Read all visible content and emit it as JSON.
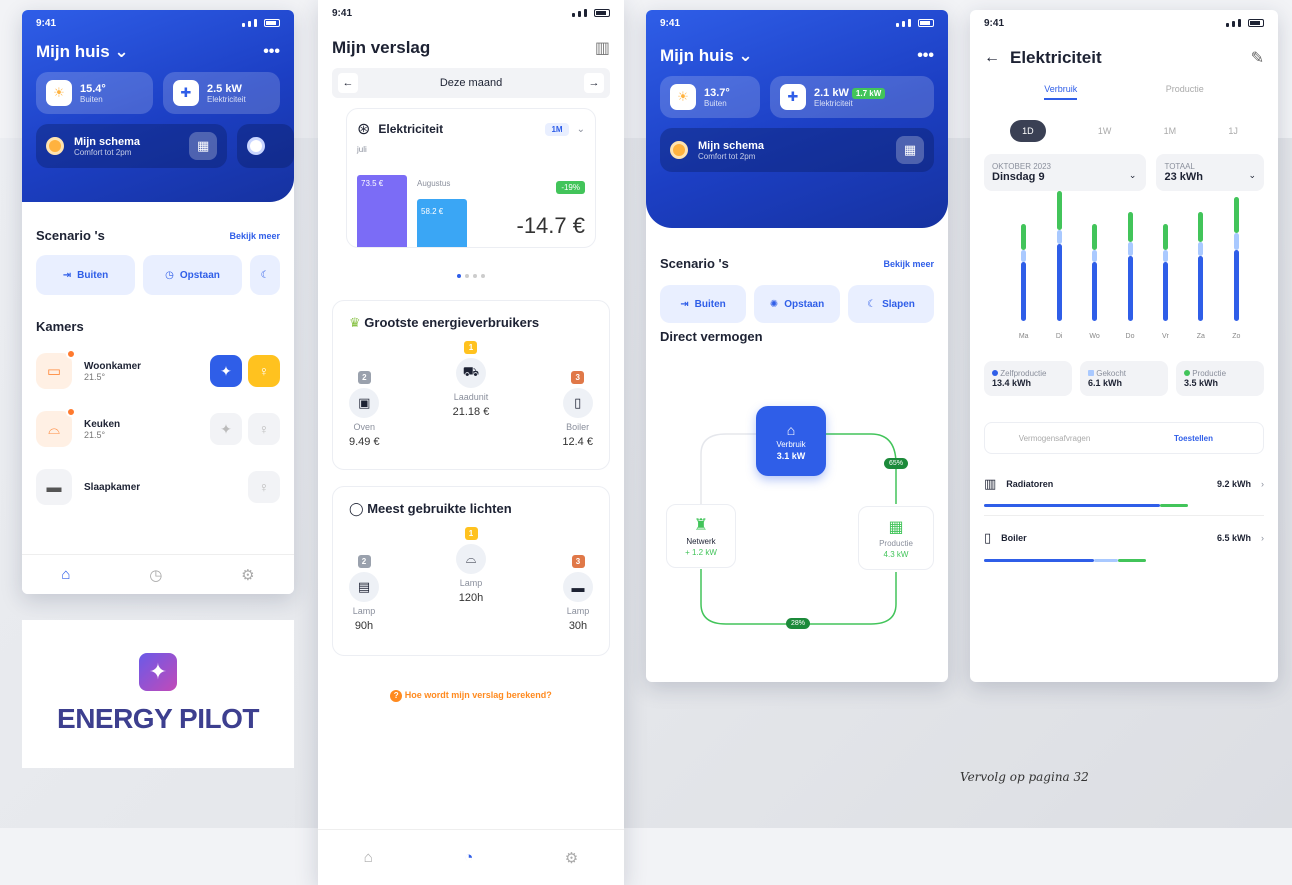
{
  "colors": {
    "accent": "#2f5ee8",
    "dark_blue": "#1632a0",
    "green": "#42c45a",
    "orange": "#ffb23f",
    "purple": "#7b6cf6"
  },
  "status": {
    "time": "9:41"
  },
  "screen1": {
    "title": "Mijn huis",
    "chips": [
      {
        "value": "15.4°",
        "label": "Buiten",
        "icon": "sun-icon"
      },
      {
        "value": "2.5 kW",
        "label": "Elektriciteit",
        "icon": "plus-icon"
      }
    ],
    "schedule": {
      "title": "Mijn schema",
      "subtitle": "Comfort tot 2pm"
    },
    "scenarios_title": "Scenario 's",
    "scenarios_more": "Bekijk meer",
    "scenarios": [
      "Buiten",
      "Opstaan",
      ""
    ],
    "rooms_title": "Kamers",
    "rooms": [
      {
        "name": "Woonkamer",
        "temp": "21.5°"
      },
      {
        "name": "Keuken",
        "temp": "21.5°"
      },
      {
        "name": "Slaapkamer",
        "temp": ""
      }
    ]
  },
  "logo": {
    "text": "ENERGY PILOT"
  },
  "screen2": {
    "title": "Mijn verslag",
    "period": "Deze maand",
    "card": {
      "title": "Elektriciteit",
      "toggle": "1M",
      "label_prev": "juli",
      "bar1": "73.5 €",
      "label_now": "Augustus",
      "bar2": "58.2 €",
      "change": "-19%",
      "diff": "-14.7 €"
    },
    "consumers": {
      "title": "Grootste energieverbruikers",
      "items": [
        {
          "rank": "2",
          "name": "Oven",
          "value": "9.49 €"
        },
        {
          "rank": "1",
          "name": "Laadunit",
          "value": "21.18 €"
        },
        {
          "rank": "3",
          "name": "Boiler",
          "value": "12.4 €"
        }
      ]
    },
    "lights": {
      "title": "Meest gebruikte lichten",
      "items": [
        {
          "rank": "2",
          "name": "Lamp",
          "value": "90h"
        },
        {
          "rank": "1",
          "name": "Lamp",
          "value": "120h"
        },
        {
          "rank": "3",
          "name": "Lamp",
          "value": "30h"
        }
      ]
    },
    "help": "Hoe wordt mijn verslag berekend?"
  },
  "screen3": {
    "title": "Mijn huis",
    "chips": [
      {
        "value": "13.7°",
        "label": "Buiten",
        "icon": "sun-icon"
      },
      {
        "value": "2.1 kW",
        "badge": "1.7 kW",
        "label": "Elektriciteit",
        "icon": "plus-icon"
      }
    ],
    "schedule": {
      "title": "Mijn schema",
      "subtitle": "Comfort tot 2pm"
    },
    "scenarios_title": "Scenario 's",
    "scenarios_more": "Bekijk meer",
    "scenarios": [
      "Buiten",
      "Opstaan",
      "Slapen"
    ],
    "direct_title": "Direct vermogen",
    "flow": {
      "center_label": "Verbruik",
      "center_value": "3.1 kW",
      "left_label": "Netwerk",
      "left_value": "+ 1.2 kW",
      "right_label": "Productie",
      "right_value": "4.3 kW",
      "pct_right": "65%",
      "pct_bottom": "28%"
    }
  },
  "screen4": {
    "title": "Elektriciteit",
    "tabs": [
      "Verbruik",
      "Productie"
    ],
    "ranges": [
      "1D",
      "1W",
      "1M",
      "1J"
    ],
    "date_label": "OKTOBER 2023",
    "date_value": "Dinsdag 9",
    "total_label": "TOTAAL",
    "total_value": "23 kWh",
    "days": [
      "Ma",
      "Di",
      "Wo",
      "Do",
      "Vr",
      "Za",
      "Zo"
    ],
    "legend": [
      {
        "name": "Zelfproductie",
        "value": "13.4 kWh"
      },
      {
        "name": "Gekocht",
        "value": "6.1 kWh"
      },
      {
        "name": "Productie",
        "value": "3.5 kWh"
      }
    ],
    "toggle": [
      "Vermogensafvragen",
      "Toestellen"
    ],
    "devices": [
      {
        "name": "Radiatoren",
        "value": "9.2 kWh"
      },
      {
        "name": "Boiler",
        "value": "6.5 kWh"
      }
    ]
  },
  "chart_data": {
    "type": "bar",
    "categories": [
      "Ma",
      "Di",
      "Wo",
      "Do",
      "Vr",
      "Za",
      "Zo"
    ],
    "series": [
      {
        "values": [
          2.0,
          2.6,
          2.0,
          2.2,
          2.0,
          2.2,
          2.4
        ]
      },
      {
        "values": [
          0.4,
          0.5,
          0.4,
          0.5,
          0.4,
          0.5,
          0.6
        ]
      },
      {
        "values": [
          0.9,
          1.3,
          0.9,
          1.0,
          0.9,
          1.0,
          1.2
        ]
      }
    ]
  },
  "caption": "Vervolg op pagina 32"
}
